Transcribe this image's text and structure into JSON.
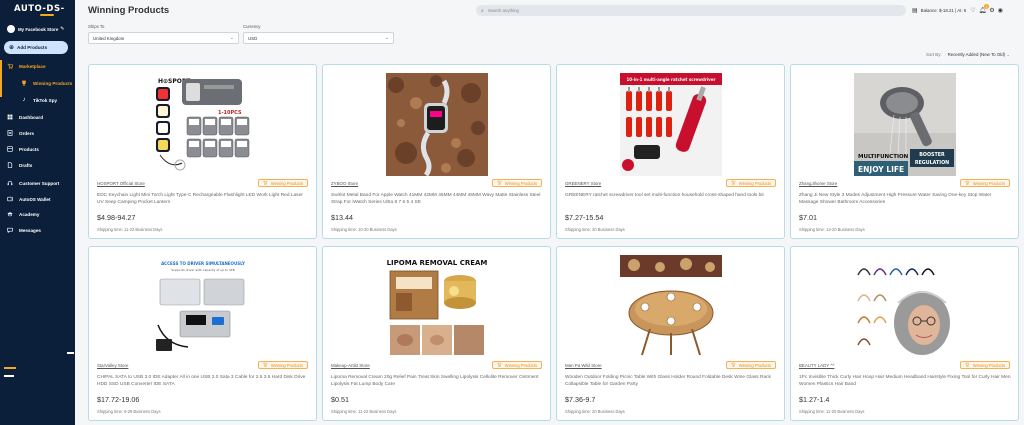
{
  "sidebar": {
    "logo": "AUTO-DS-",
    "store_name": "My Facebook Store",
    "add_products": "Add Products",
    "items": [
      {
        "label": "Marketplace",
        "icon": "cart-icon"
      },
      {
        "label": "Winning Products",
        "icon": "trophy-icon"
      },
      {
        "label": "TikTok Spy",
        "icon": "tiktok-icon"
      },
      {
        "label": "Dashboard",
        "icon": "dashboard-icon"
      },
      {
        "label": "Orders",
        "icon": "orders-icon"
      },
      {
        "label": "Products",
        "icon": "products-icon"
      },
      {
        "label": "Drafts",
        "icon": "drafts-icon"
      },
      {
        "label": "Customer Support",
        "icon": "support-icon"
      },
      {
        "label": "AutoDS Wallet",
        "icon": "wallet-icon"
      },
      {
        "label": "Academy",
        "icon": "academy-icon"
      },
      {
        "label": "Messages",
        "icon": "messages-icon"
      }
    ]
  },
  "header": {
    "title": "Winning Products",
    "search_placeholder": "Search anything",
    "balance": "Balance: $-18.21 | AI: 6",
    "notification_count": "1"
  },
  "filters": {
    "ships_to_label": "Ships To",
    "ships_to_value": "United Kingdom",
    "currency_label": "Currency",
    "currency_value": "USD",
    "sort_by_label": "Sort By:",
    "sort_by_value": "Recently Added (New To Old)"
  },
  "badge_label": "Winning Products",
  "products": [
    {
      "store": "HOSPORT Official Store",
      "title": "EDC Keychain Light Mini Torch Light Type-C Rechargeable Flashlight LED Work Light Red Laser UV Seep Camping Pocket Lantern",
      "price": "$4.98-94.27",
      "shipping": "Shipping time: 11-22 Business Days"
    },
    {
      "store": "ZYBOO Store",
      "title": "Swirlot Metal Band For Apple Watch 41MM 42MM 46MM 44MM 45MM Wavy Matte Stainless Steel Strap For iWatch Series Ultra 8 7 6 5 4 SE",
      "price": "$13.44",
      "shipping": "Shipping time: 10-20 Business Days"
    },
    {
      "store": "GREENERY Store",
      "title": "GREENERY ratchet screwdriver tool set multi-function household cross-shaped hand tools bit",
      "price": "$7.27-15.54",
      "shipping": "Shipping time: 20 Business Days"
    },
    {
      "store": "ZhangJihome Store",
      "title": "Zhang Ji New Style 3 Modes Adjustment High Pressure Water Saving One-key Stop Water Massage Shower Bathroom Accessories",
      "price": "$7.01",
      "shipping": "Shipping time: 13-20 Business Days"
    },
    {
      "store": "StarValley Store",
      "title": "CHIPAL SATA to USB 3.0 IDE Adapter All in one USB 2.0 Sata 3 Cable for 2.5 3.5 Hard Disk Drive HDD SSD USB Converter IDE SATA",
      "price": "$17.72-19.06",
      "shipping": "Shipping time: 8-29 Business Days"
    },
    {
      "store": "Makeup-Artist Store",
      "title": "Lipoma Removal Cream 20g Relief Pain Treat Skin Swelling Lipolysis Cellulite Remover Ointment Lipolysis Fat Lump Body Care",
      "price": "$0.51",
      "shipping": "Shipping time: 11-22 Business Days"
    },
    {
      "store": "Man Pa Wild Store",
      "title": "Wooden Outdoor Folding Picnic Table With Glass Holder Round Foldable Desk Wine Glass Rack Collapsible Table for Garden Party",
      "price": "$7.36-9.7",
      "shipping": "Shipping time: 20 Business Days"
    },
    {
      "store": "BEAUTY LADY ^^",
      "title": "1Pc Invisible Thick Curly Hair Hoop Hair Medium Headband Hairstyle Fixing Tool for Curly Hair Men Women Plastics Hair Band",
      "price": "$1.27-1.4",
      "shipping": "Shipping time: 11-20 Business Days"
    }
  ],
  "image_text": {
    "p1_brand": "H⊙SPORT",
    "p1_tag": "1-10PCS",
    "p3_banner": "10-in-1 multi-angle ratchet screwdriver",
    "p4_line1": "MULTIFUNCTION",
    "p4_badge1": "BOOSTER",
    "p4_badge2": "REGULATION",
    "p4_line2": "ENJOY LIFE",
    "p5_line1": "ACCESS TO DRIVER SIMULTANEOUSLY",
    "p5_line2": "Supports driver with capacity of up to 4TB",
    "p6_title": "LIPOMA REMOVAL CREAM"
  },
  "colors": {
    "sidebar_bg": "#0b1f3a",
    "accent": "#f5a623",
    "card_border": "#b8dce6",
    "add_button_bg": "#cfe3ff"
  }
}
